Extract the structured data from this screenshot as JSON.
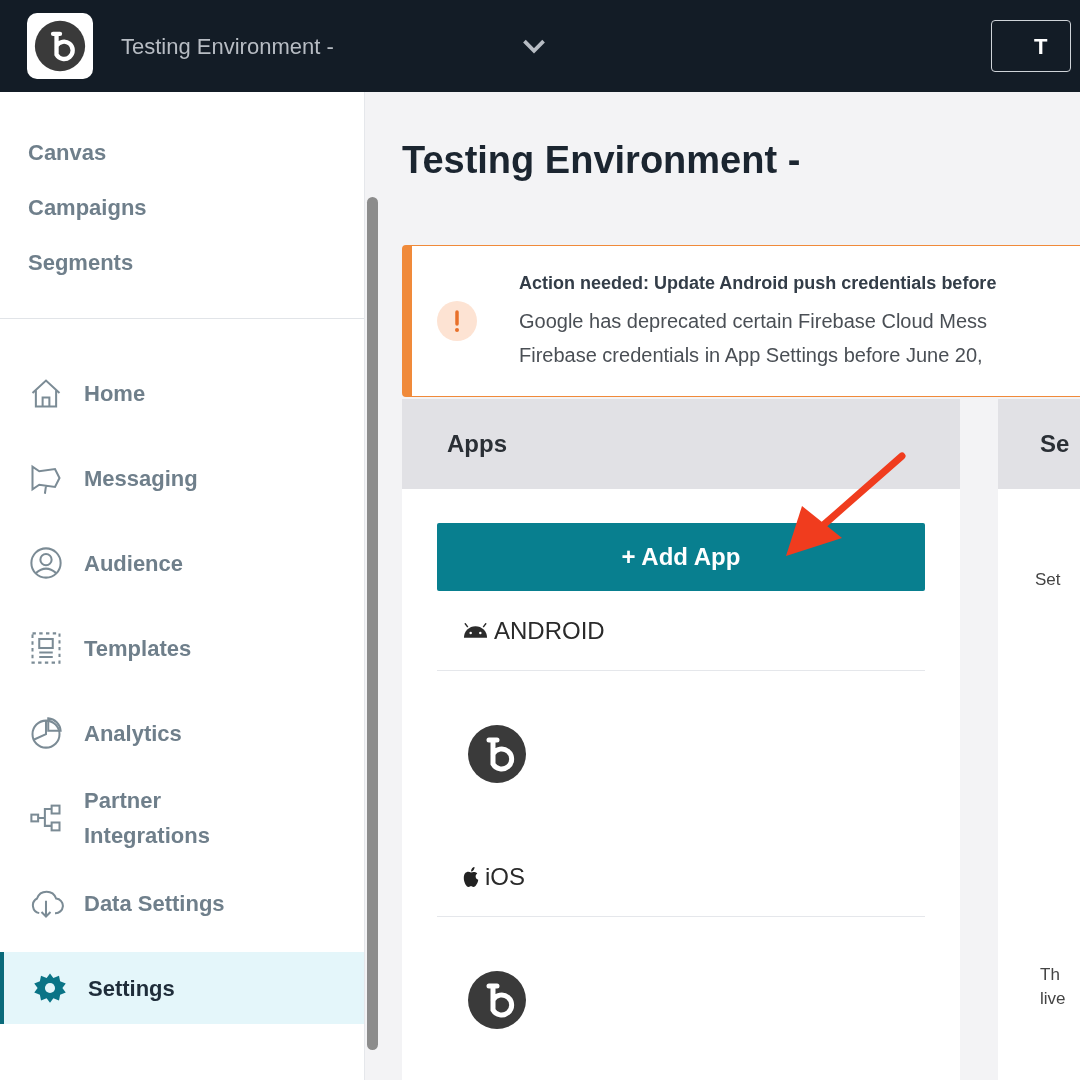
{
  "top_bar": {
    "workspace": "Testing Environment -",
    "button_text": "T"
  },
  "sidebar": {
    "top_links": [
      "Canvas",
      "Campaigns",
      "Segments"
    ],
    "items": [
      {
        "label": "Home",
        "selected": false
      },
      {
        "label": "Messaging",
        "selected": false
      },
      {
        "label": "Audience",
        "selected": false
      },
      {
        "label": "Templates",
        "selected": false
      },
      {
        "label": "Analytics",
        "selected": false
      },
      {
        "label": "Partner Integrations",
        "selected": false
      },
      {
        "label": "Data Settings",
        "selected": false
      },
      {
        "label": "Settings",
        "selected": true
      }
    ]
  },
  "page_title": "Testing Environment -",
  "alert": {
    "title": "Action needed: Update Android push credentials before",
    "lines": [
      "Google has deprecated certain Firebase Cloud Mess",
      "Firebase credentials in App Settings before June 20,"
    ]
  },
  "apps_panel": {
    "title": "Apps",
    "add_button": "+ Add App",
    "platforms": [
      {
        "kind": "android",
        "label": "ANDROID"
      },
      {
        "kind": "ios",
        "label": "iOS"
      }
    ]
  },
  "panel_2": {
    "title": "Se",
    "lines": [
      "Set",
      "Th",
      "live"
    ]
  }
}
